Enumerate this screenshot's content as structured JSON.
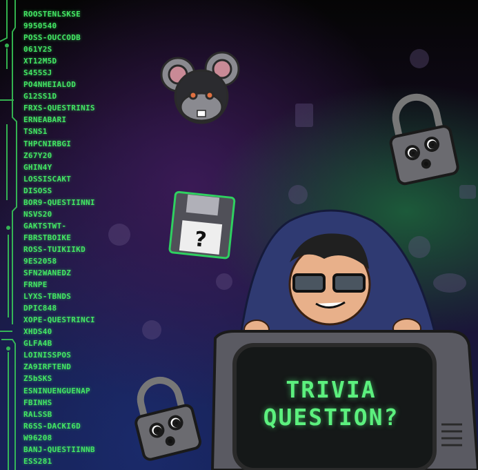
{
  "code_lines": [
    "ROOSTENLSKSE",
    "9950540",
    "POSS-OUCCODB",
    "061Y2S",
    "XT12M5D",
    "S455SJ",
    "PO4NHEIALOD",
    "G12SS1D",
    "FRXS-QUESTRINIS",
    "ERNEABARI",
    "TSNS1",
    "THPCNIRBGI",
    "Z67Y20",
    "GHIN4Y",
    "LOSSISCAKT",
    "DISOSS",
    "BOR9-QUESTIINNI",
    "NSVS20",
    "GAKTSTWT-",
    "FBRSTBOIKE",
    "ROSS-TUIKIIKD",
    "9ES2058",
    "SFN2WANEDZ",
    "FRNPE",
    "LYXS-TBNDS",
    "DPIC848",
    "XOPE-QUESTRINCI",
    "XHDS40",
    "GLFA4B",
    "LOINISSPOS",
    "ZA9IRFTEND",
    "Z5bSKS",
    "ESNINUENGUENAP",
    "FBINHS",
    "RALSSB",
    "R6SS-DACKI6D",
    "W96208",
    "BANJ-QUESTIINNB",
    "ESS281"
  ],
  "monitor": {
    "line1": "TRIVIA",
    "line2": "QUESTION?"
  },
  "colors": {
    "code_green": "#43e564",
    "screen_green": "#5cf07e"
  },
  "icons": [
    "hacker-mouse-icon",
    "padlock-icon",
    "floppy-disk-icon",
    "hooded-hacker",
    "crt-monitor",
    "padlock-small-icon"
  ]
}
